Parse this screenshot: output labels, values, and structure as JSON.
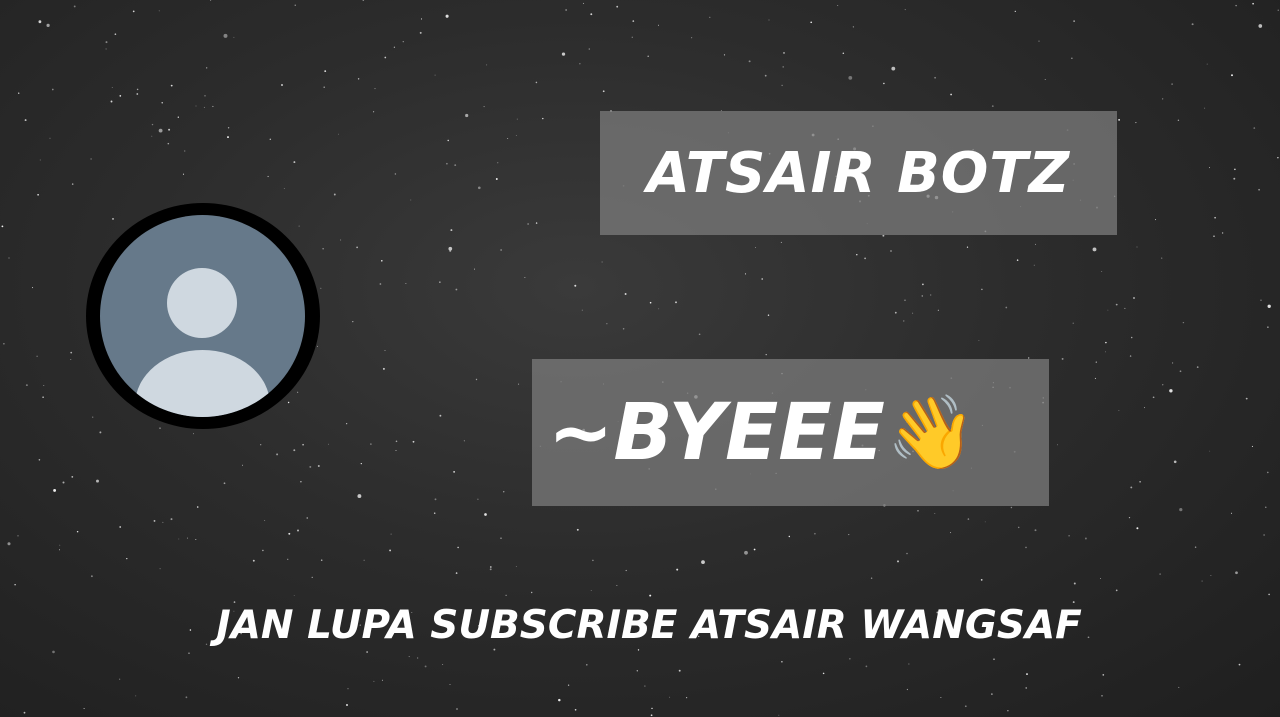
{
  "title": "ATSAIR BOTZ",
  "farewell": {
    "text": "~BYEEE",
    "emoji": "👋",
    "emoji_name": "waving-hand-icon"
  },
  "footer": "JAN LUPA SUBSCRIBE ATSAIR WANGSAF",
  "avatar": {
    "icon": "default-user-avatar-icon"
  },
  "colors": {
    "background": "#2c2c2c",
    "label_box": "#787878",
    "avatar_bg": "#66798a",
    "avatar_figure": "#cfd8e0",
    "text": "#ffffff"
  }
}
